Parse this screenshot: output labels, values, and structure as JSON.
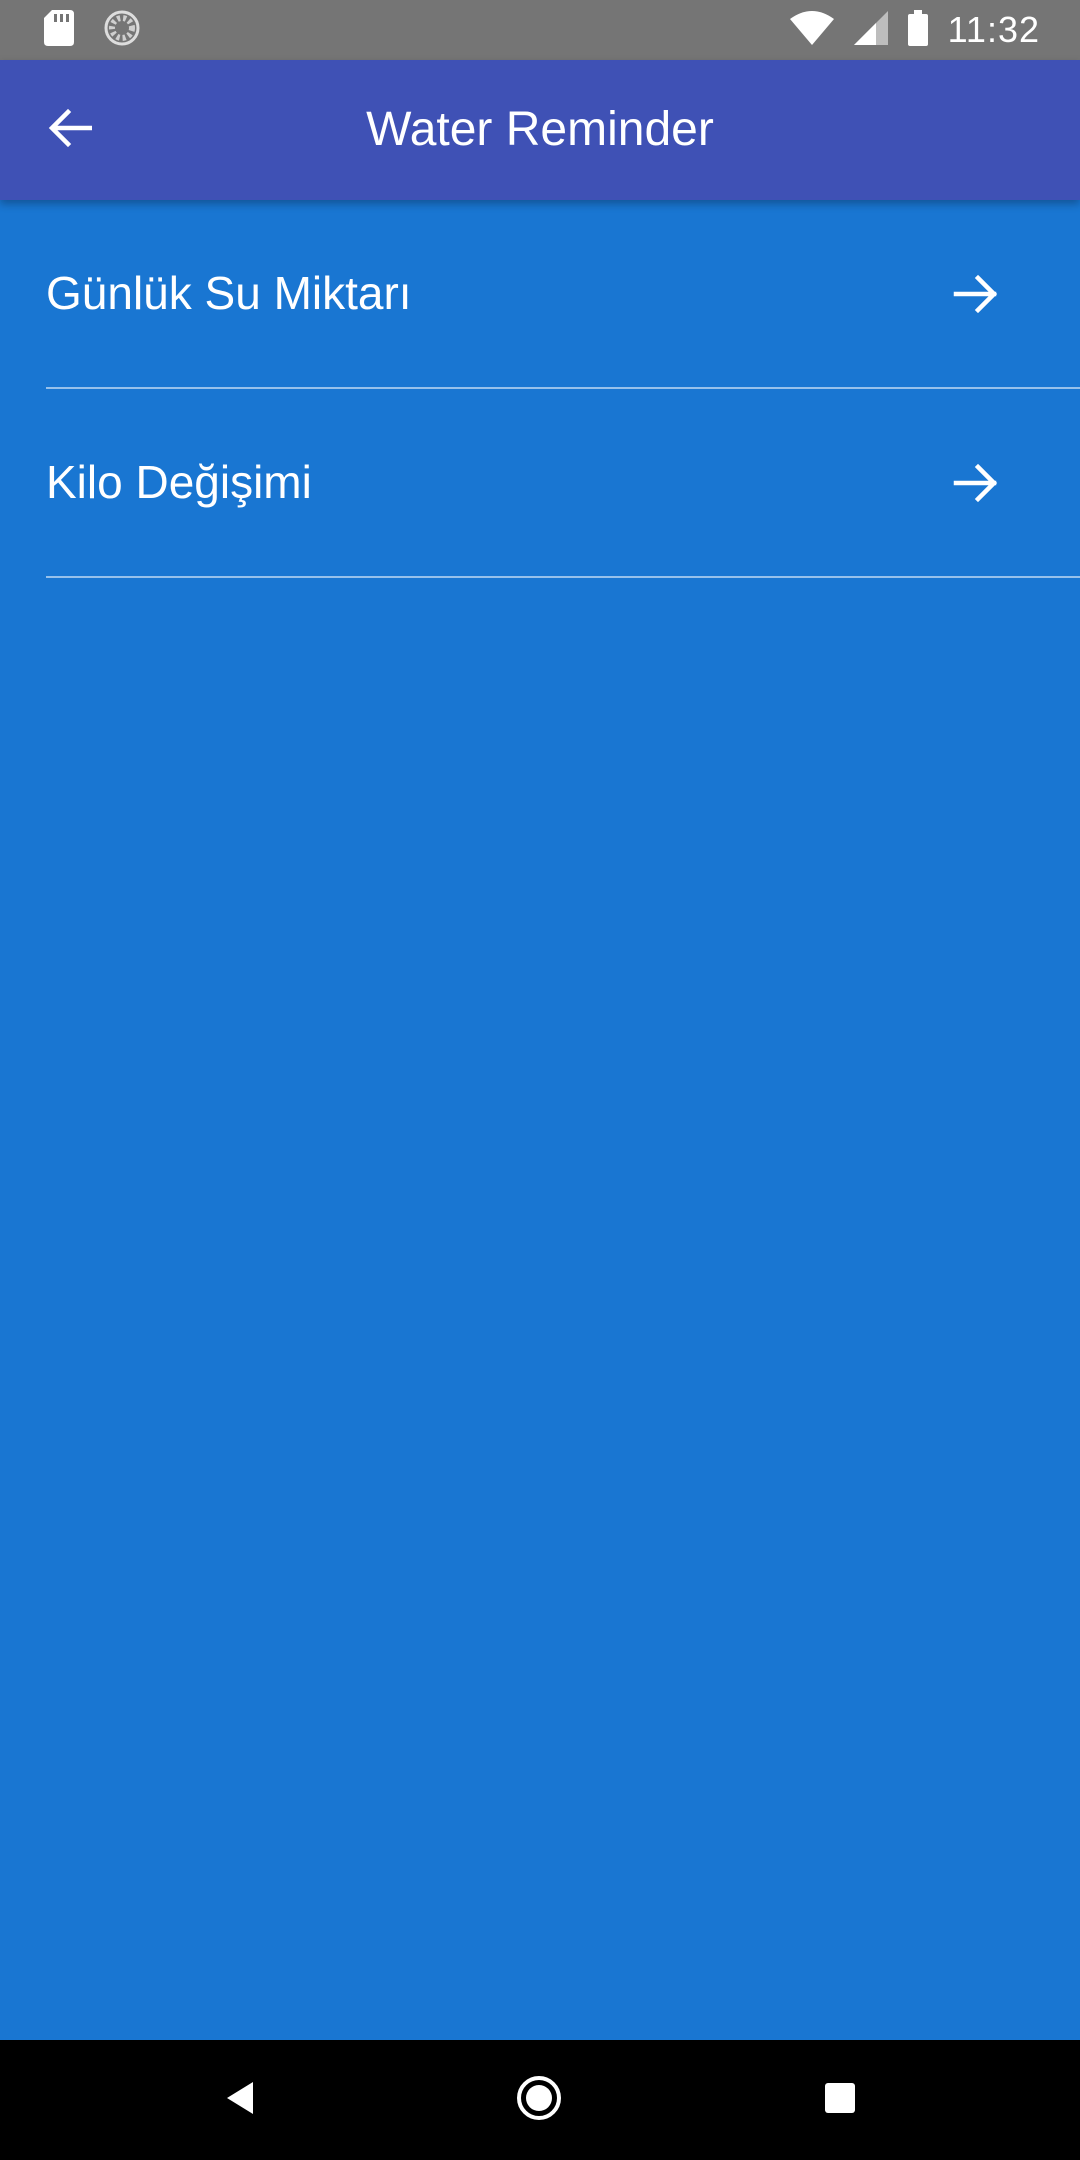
{
  "status_bar": {
    "time": "11:32",
    "left_icons": [
      "sd-card-icon",
      "sync-icon"
    ],
    "right_icons": [
      "wifi-icon",
      "cell-signal-icon",
      "battery-icon"
    ]
  },
  "app_bar": {
    "title": "Water Reminder",
    "back_icon": "arrow-back-icon",
    "color": "#3F51B5"
  },
  "list": {
    "items": [
      {
        "label": "Günlük Su Miktarı",
        "icon": "arrow-forward-icon"
      },
      {
        "label": "Kilo Değişimi",
        "icon": "arrow-forward-icon"
      }
    ]
  },
  "colors": {
    "background": "#1976D2",
    "status_bar": "#757575",
    "nav_bar": "#000000",
    "text": "#FFFFFF"
  },
  "nav_bar": {
    "buttons": [
      "nav-back-icon",
      "nav-home-icon",
      "nav-recents-icon"
    ]
  }
}
